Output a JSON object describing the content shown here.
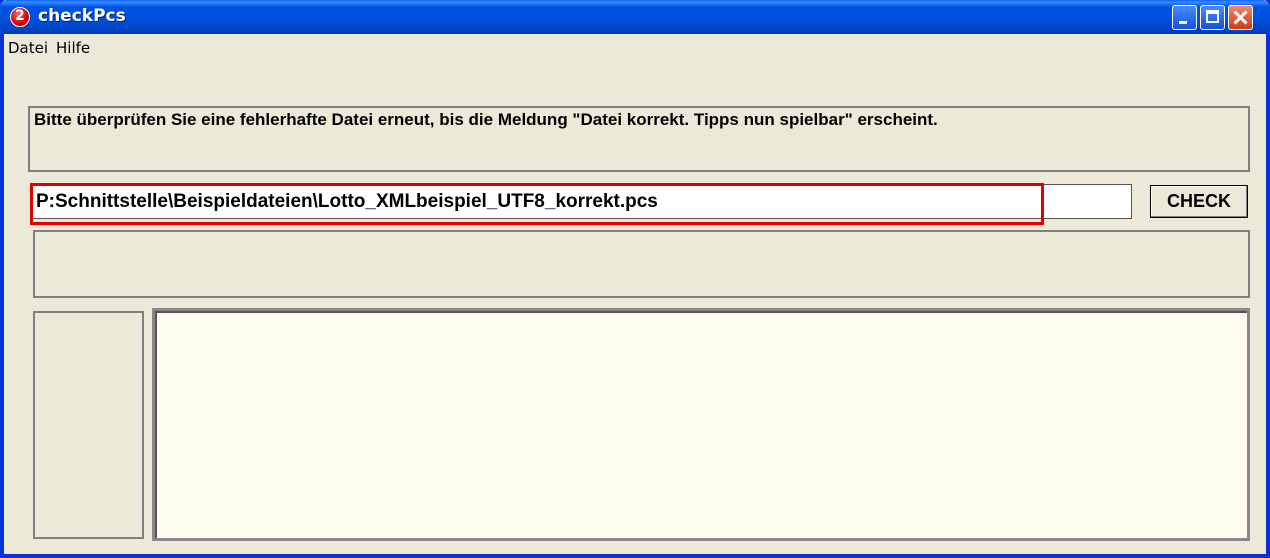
{
  "window": {
    "title": "checkPcs"
  },
  "menu": {
    "items": [
      {
        "label": "Datei"
      },
      {
        "label": "Hilfe"
      }
    ]
  },
  "message": {
    "text": "Bitte überprüfen Sie eine fehlerhafte Datei erneut, bis die Meldung \"Datei korrekt. Tipps nun spielbar\" erscheint."
  },
  "path_input": {
    "value": "P:Schnittstelle\\Beispieldateien\\Lotto_XMLbeispiel_UTF8_korrekt.pcs"
  },
  "check_button": {
    "label": "CHECK"
  },
  "status": {
    "text": ""
  },
  "colors": {
    "titlebar": "#0054E3",
    "window_bg": "#ECE9D8",
    "highlight": "#E00000",
    "text_area_bg": "#FFFCF0"
  },
  "icons": {
    "app": "app-icon",
    "minimize": "minimize-icon",
    "maximize": "maximize-icon",
    "close": "close-icon"
  }
}
